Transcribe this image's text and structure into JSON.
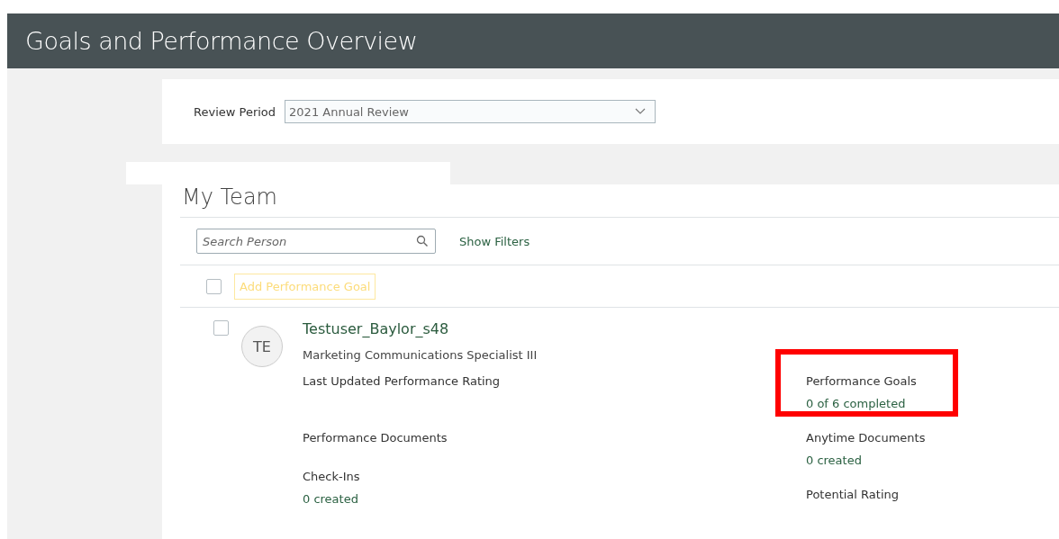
{
  "header": {
    "title": "Goals and Performance Overview"
  },
  "review_period": {
    "label": "Review Period",
    "value": "2021 Annual Review"
  },
  "team": {
    "title": "My Team",
    "search": {
      "placeholder": "Search Person"
    },
    "show_filters": "Show Filters",
    "select_all": {
      "checked": false
    },
    "add_goal": {
      "label": "Add Performance Goal",
      "disabled": true
    },
    "members": [
      {
        "checked": false,
        "initials": "TE",
        "name": "Testuser_Baylor_s48",
        "job": "Marketing Communications Specialist III",
        "metrics_left": [
          {
            "label": "Last Updated Performance Rating"
          },
          {
            "label": "Performance Documents"
          },
          {
            "label": "Check-Ins",
            "value": "0 created"
          }
        ],
        "metrics_right": [
          {
            "label": "Performance Goals",
            "value": "0 of 6 completed",
            "highlighted": true
          },
          {
            "label": "Anytime Documents",
            "value": "0 created"
          },
          {
            "label": "Potential Rating"
          }
        ]
      }
    ]
  }
}
